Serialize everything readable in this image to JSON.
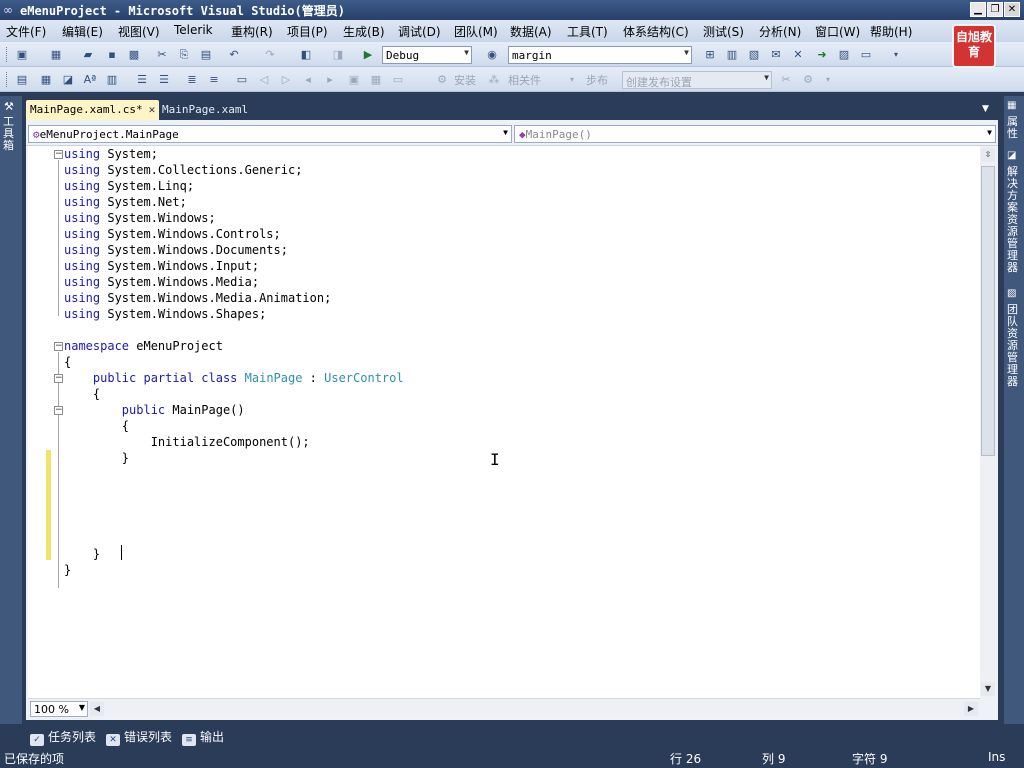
{
  "window": {
    "title": "eMenuProject - Microsoft Visual Studio(管理员)",
    "minimize": "▁",
    "restore": "❐",
    "close": "✕"
  },
  "menu": {
    "file": "文件(F)",
    "edit": "编辑(E)",
    "view": "视图(V)",
    "telerik": "Telerik",
    "refactor": "重构(R)",
    "project": "项目(P)",
    "build": "生成(B)",
    "debug": "调试(D)",
    "team": "团队(M)",
    "data": "数据(A)",
    "tools": "工具(T)",
    "architecture": "体系结构(C)",
    "test": "测试(S)",
    "analyze": "分析(N)",
    "window": "窗口(W)",
    "help": "帮助(H)"
  },
  "toolbar": {
    "config_value": "Debug",
    "find_value": "margin",
    "install_label": "安装",
    "related_label": "相关件",
    "step_label": "步布",
    "publish_placeholder": "创建发布设置"
  },
  "brand": {
    "logo_text": "自旭教育"
  },
  "side": {
    "toolbox_label": "工具箱",
    "properties_label": "属性",
    "solution_label": "解决方案资源管理器",
    "team_label": "团队资源管理器"
  },
  "tabs": [
    {
      "label": "MainPage.xaml.cs*",
      "active": true
    },
    {
      "label": "MainPage.xaml",
      "active": false
    }
  ],
  "navbar": {
    "class_value": "eMenuProject.MainPage",
    "member_value": "MainPage()"
  },
  "code": [
    [
      [
        "kw",
        "using"
      ],
      [
        "pl",
        " System;"
      ]
    ],
    [
      [
        "kw",
        "using"
      ],
      [
        "pl",
        " System.Collections.Generic;"
      ]
    ],
    [
      [
        "kw",
        "using"
      ],
      [
        "pl",
        " System.Linq;"
      ]
    ],
    [
      [
        "kw",
        "using"
      ],
      [
        "pl",
        " System.Net;"
      ]
    ],
    [
      [
        "kw",
        "using"
      ],
      [
        "pl",
        " System.Windows;"
      ]
    ],
    [
      [
        "kw",
        "using"
      ],
      [
        "pl",
        " System.Windows.Controls;"
      ]
    ],
    [
      [
        "kw",
        "using"
      ],
      [
        "pl",
        " System.Windows.Documents;"
      ]
    ],
    [
      [
        "kw",
        "using"
      ],
      [
        "pl",
        " System.Windows.Input;"
      ]
    ],
    [
      [
        "kw",
        "using"
      ],
      [
        "pl",
        " System.Windows.Media;"
      ]
    ],
    [
      [
        "kw",
        "using"
      ],
      [
        "pl",
        " System.Windows.Media.Animation;"
      ]
    ],
    [
      [
        "kw",
        "using"
      ],
      [
        "pl",
        " System.Windows.Shapes;"
      ]
    ],
    [],
    [
      [
        "kw",
        "namespace"
      ],
      [
        "pl",
        " eMenuProject"
      ]
    ],
    [
      [
        "pl",
        "{"
      ]
    ],
    [
      [
        "pl",
        "    "
      ],
      [
        "kw",
        "public partial class"
      ],
      [
        "pl",
        " "
      ],
      [
        "ty",
        "MainPage"
      ],
      [
        "pl",
        " : "
      ],
      [
        "ty",
        "UserControl"
      ]
    ],
    [
      [
        "pl",
        "    {"
      ]
    ],
    [
      [
        "pl",
        "        "
      ],
      [
        "kw",
        "public"
      ],
      [
        "pl",
        " MainPage()"
      ]
    ],
    [
      [
        "pl",
        "        {"
      ]
    ],
    [
      [
        "pl",
        "            InitializeComponent();"
      ]
    ],
    [
      [
        "pl",
        "        }"
      ]
    ],
    [],
    [],
    [],
    [],
    [],
    [
      [
        "pl",
        "    }"
      ]
    ],
    [
      [
        "pl",
        "}"
      ]
    ]
  ],
  "editor": {
    "zoom_value": "100 %"
  },
  "bottom_tabs": {
    "tasks": "任务列表",
    "errors": "错误列表",
    "output": "输出"
  },
  "status": {
    "message": "已保存的项",
    "line": "行 26",
    "col": "列 9",
    "char": "字符 9",
    "mode": "Ins"
  },
  "colors": {
    "keyword": "#1a1ab4",
    "type": "#2b91af",
    "chrome": "#2b3c59",
    "active_tab": "#fff4c6"
  }
}
